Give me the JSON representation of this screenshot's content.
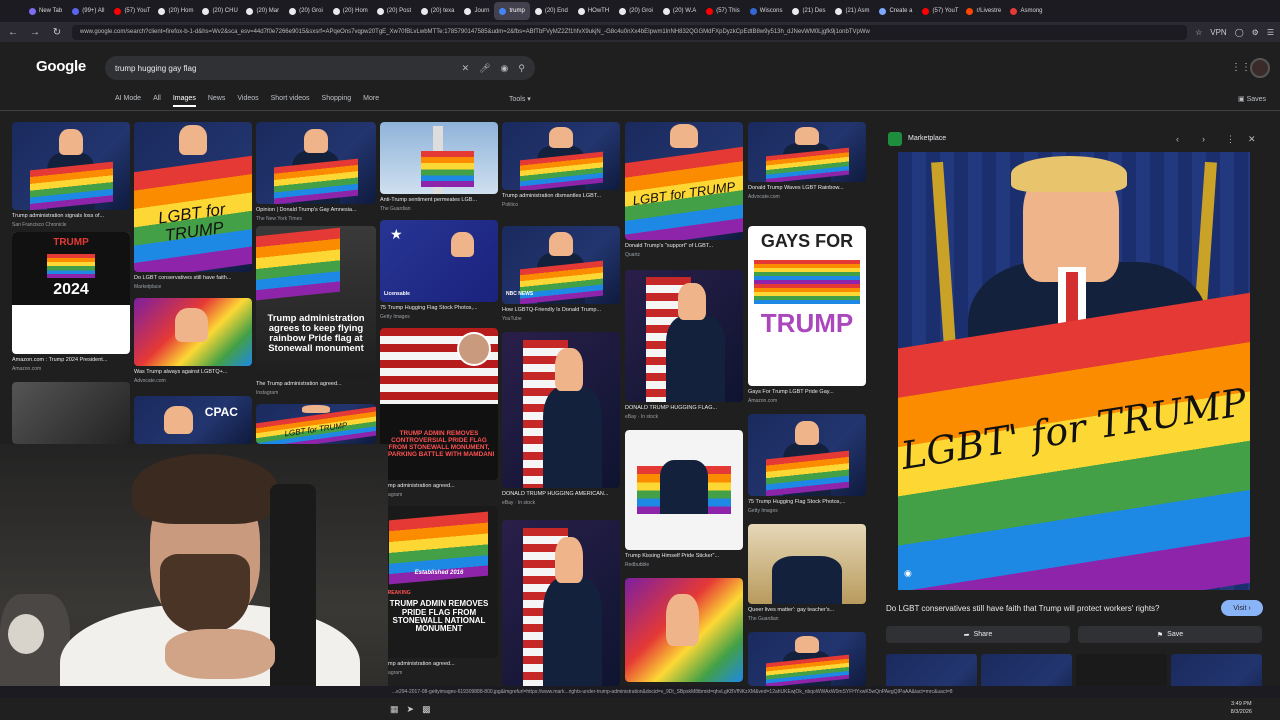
{
  "browser": {
    "tabs": [
      {
        "label": "New Tab",
        "color": "#7c6cf0"
      },
      {
        "label": "(99+) All",
        "color": "#5865f2"
      },
      {
        "label": "(57) YouT",
        "color": "#ff0000"
      },
      {
        "label": "(20) Hom",
        "color": "#e8eaed"
      },
      {
        "label": "(20) CHU",
        "color": "#e8eaed"
      },
      {
        "label": "(20) Mar",
        "color": "#e8eaed"
      },
      {
        "label": "(20) Groi",
        "color": "#e8eaed"
      },
      {
        "label": "(20) Hom",
        "color": "#e8eaed"
      },
      {
        "label": "(20) Post",
        "color": "#e8eaed"
      },
      {
        "label": "(20) texa",
        "color": "#e8eaed"
      },
      {
        "label": "Journ",
        "color": "#e8eaed"
      },
      {
        "label": "trump",
        "color": "#4285f4",
        "active": true
      },
      {
        "label": "(20) End",
        "color": "#e8eaed"
      },
      {
        "label": "HOwTH",
        "color": "#e8eaed"
      },
      {
        "label": "(20) Groi",
        "color": "#e8eaed"
      },
      {
        "label": "(20) W.A",
        "color": "#e8eaed"
      },
      {
        "label": "(57) This",
        "color": "#ff0000"
      },
      {
        "label": "Wiscons",
        "color": "#3367d6"
      },
      {
        "label": "(21) Des",
        "color": "#e8eaed"
      },
      {
        "label": "(21) Asm",
        "color": "#e8eaed"
      },
      {
        "label": "Create a",
        "color": "#7aa7ff"
      },
      {
        "label": "(57) YouT",
        "color": "#ff0000"
      },
      {
        "label": "r/Livestre",
        "color": "#ff4500"
      },
      {
        "label": "Asmong",
        "color": "#e53935"
      }
    ],
    "url": "www.google.com/search?client=firefox-b-1-d&hs=Wv2&sca_esv=44d7f0e7266e9015&sxsrf=APqeOns7vqpw20TgE_Xw70fBLvLwbMTTe:1785790147585&udm=2&fbs=ABfTbFVyMZ2Zf1hfvX9ukjN_-G8c4u0nXx4bEIpwm1lnNH832QGGMdFXpDyzkCpEdtB8w9y513h_dJNevWM0Ljgfk9j1onbTVpWw",
    "vpn_label": "VPN"
  },
  "google": {
    "logo": "Google",
    "query": "trump hugging gay flag",
    "filters": [
      "AI Mode",
      "All",
      "Images",
      "News",
      "Videos",
      "Short videos",
      "Shopping",
      "More"
    ],
    "active_filter": "Images",
    "tools_label": "Tools",
    "saves_label": "Saves"
  },
  "results": [
    {
      "caption": "Trump administration signals loss of...",
      "source": "San Francisco Chronicle"
    },
    {
      "caption": "Do LGBT conservatives still have faith...",
      "source": "Marketplace"
    },
    {
      "caption": "Opinion | Donald Trump's Gay Amnesia...",
      "source": "The New York Times"
    },
    {
      "caption": "Anti-Trump sentiment permeates LGB...",
      "source": "The Guardian"
    },
    {
      "caption": "Trump administration dismantles LGBT...",
      "source": "Politico"
    },
    {
      "caption": "Donald Trump's \"support\" of LGBT...",
      "source": "Quartz"
    },
    {
      "caption": "Donald Trump Waves LGBT Rainbow...",
      "source": "Advocate.com"
    },
    {
      "caption": "Amazon.com : Trump 2024 President...",
      "source": "Amazon.com"
    },
    {
      "caption": "Was Trump always against LGBTQ+...",
      "source": "Advocate.com"
    },
    {
      "caption": "The Trump administration agreed...",
      "source": "Instagram"
    },
    {
      "caption": "75 Trump Hugging Flag Stock Photos,...",
      "source": "Getty Images"
    },
    {
      "caption": "How LGBTQ-Friendly Is Donald Trump...",
      "source": "YouTube"
    },
    {
      "caption": "DONALD TRUMP HUGGING FLAG...",
      "source": "eBay · In stock"
    },
    {
      "caption": "Gays For Trump LGBT Pride Gay...",
      "source": "Amazon.com"
    },
    {
      "caption": "Trump administration agreed...",
      "source": "Instagram"
    },
    {
      "caption": "DONALD TRUMP HUGGING AMERICAN...",
      "source": "eBay · In stock"
    },
    {
      "caption": "Trump Kissing Himself Pride Sticker\"...",
      "source": "Redbubble"
    },
    {
      "caption": "75 Trump Hugging Flag Stock Photos,...",
      "source": "Getty Images"
    },
    {
      "caption": "Trump administration agreed...",
      "source": "Instagram"
    },
    {
      "caption": "Queer lives matter': gay teacher's...",
      "source": "The Guardian"
    }
  ],
  "overlays": {
    "t2024_top": "TRUMP",
    "t2024_year": "2024",
    "stonewall1": "Trump administration agrees to keep flying rainbow Pride flag at Stonewall monument",
    "stonewall2": "TRUMP ADMIN REMOVES CONTROVERSIAL PRIDE FLAG FROM STONEWALL MONUMENT, SPARKING BATTLE WITH MAMDANI",
    "stonewall3": "TRUMP ADMIN REMOVES PRIDE FLAG FROM STONEWALL NATIONAL MONUMENT",
    "breaking": "BREAKING",
    "established": "Established 2016",
    "gays_for": "GAYS FOR",
    "trump_word": "TRUMP",
    "flag_text": "LGBT for TRUMP",
    "nbc": "NBC NEWS",
    "licensable": "Licensable",
    "cpac": "CPAC"
  },
  "panel": {
    "source": "Marketplace",
    "flag_text": "LGBT' for TRUMP",
    "caption": "Do LGBT conservatives still have faith that Trump will protect workers' rights?",
    "visit_label": "Visit",
    "share_label": "Share",
    "save_label": "Save"
  },
  "statusbar": {
    "link": "...e294-2017-08-gettyimages-619309888-800.jpg&imgrefurl=https://www.mark...rights-under-trump-administration&docid=v_9Dt_SBpskM8tbmid=qhvLgKBVfNKzXM&ved=12ahUKEwjOk_nbqoWWAxW0mSYFHYxwK5wQnPAegQIPaAA&iact=mrc&uact=8"
  },
  "clock": {
    "time": "3:49 PM",
    "date": "8/3/2026"
  }
}
